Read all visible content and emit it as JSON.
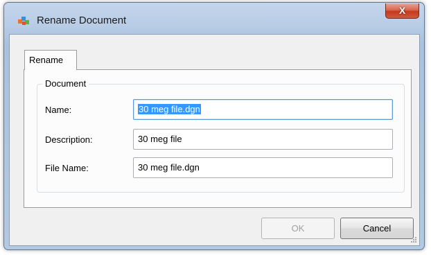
{
  "window": {
    "title": "Rename Document",
    "app_icon": "bentley-app-icon",
    "close_label": "X"
  },
  "tabs": [
    {
      "label": "Rename",
      "active": true
    }
  ],
  "group": {
    "legend": "Document"
  },
  "fields": {
    "name": {
      "label": "Name:",
      "value": "30 meg file.dgn",
      "selected": true
    },
    "description": {
      "label": "Description:",
      "value": "30 meg file"
    },
    "file_name": {
      "label": "File Name:",
      "value": "30 meg file.dgn"
    }
  },
  "buttons": {
    "ok": {
      "label": "OK",
      "enabled": false
    },
    "cancel": {
      "label": "Cancel",
      "enabled": true
    }
  },
  "colors": {
    "selection": "#3399ff",
    "close_button": "#c5391d",
    "frame": "#b9cde6"
  }
}
